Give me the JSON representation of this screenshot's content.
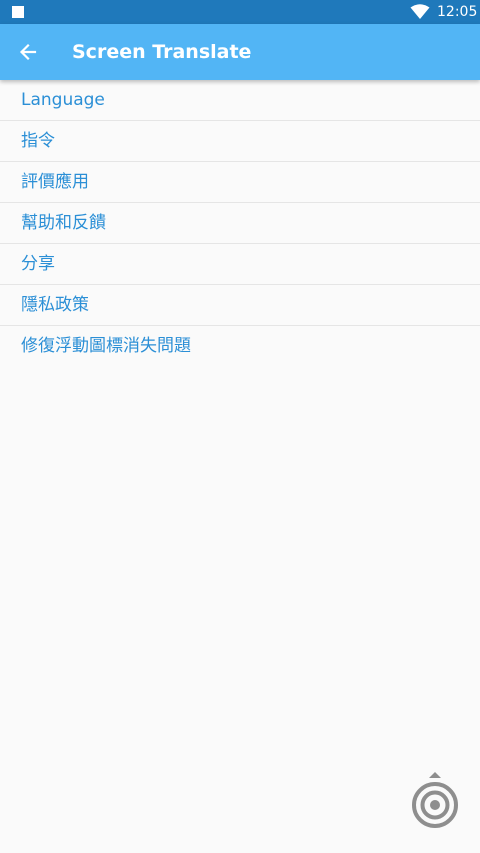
{
  "status_bar": {
    "time": "12:05",
    "icons": [
      "notification-square-icon",
      "wifi-icon"
    ]
  },
  "app_bar": {
    "title": "Screen Translate",
    "back_icon": "arrow-left-icon"
  },
  "menu": {
    "items": [
      {
        "label": "Language"
      },
      {
        "label": "指令"
      },
      {
        "label": "評價應用"
      },
      {
        "label": "幫助和反饋"
      },
      {
        "label": "分享"
      },
      {
        "label": "隱私政策"
      },
      {
        "label": "修復浮動圖標消失問題"
      }
    ]
  },
  "floating_button": {
    "icon": "target-icon"
  },
  "colors": {
    "status_bar": "#1f79bb",
    "app_bar": "#52b5f5",
    "menu_text": "#2b8fd6",
    "background": "#fafafa",
    "divider": "#e5e5e5"
  }
}
